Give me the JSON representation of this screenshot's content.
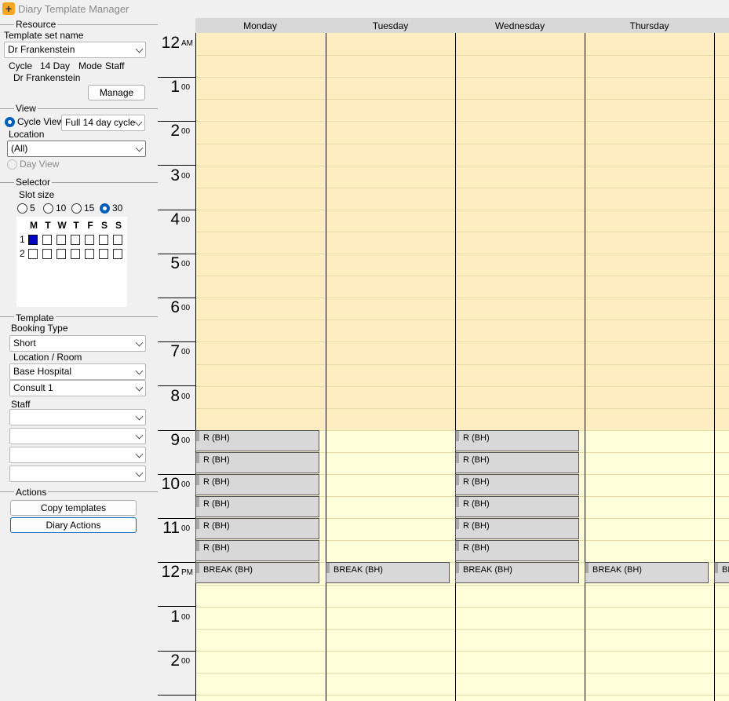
{
  "window": {
    "title": "Diary Template Manager"
  },
  "resource": {
    "group_label": "Resource",
    "template_set_label": "Template set name",
    "template_set_value": "Dr Frankenstein",
    "cycle_label": "Cycle",
    "cycle_value": "14 Day",
    "mode_label": "Mode",
    "mode_value": "Staff",
    "resource_name": "Dr Frankenstein",
    "manage_label": "Manage"
  },
  "view": {
    "group_label": "View",
    "cycle_view_label": "Cycle View",
    "cycle_view_selected": true,
    "cycle_option": "Full 14 day cycle",
    "location_label": "Location",
    "location_value": "(All)",
    "day_view_label": "Day View"
  },
  "selector": {
    "group_label": "Selector",
    "slot_size_label": "Slot size",
    "slot_sizes": [
      "5",
      "10",
      "15",
      "30"
    ],
    "selected_slot_size": "30",
    "day_letters": [
      "M",
      "T",
      "W",
      "T",
      "F",
      "S",
      "S"
    ],
    "week_rows": [
      "1",
      "2"
    ],
    "selected_cell": "week 1, M"
  },
  "template": {
    "group_label": "Template",
    "booking_type_label": "Booking Type",
    "booking_type_value": "Short",
    "location_room_label": "Location / Room",
    "location_value": "Base Hospital",
    "room_value": "Consult 1",
    "staff_label": "Staff",
    "staff_values": [
      "",
      "",
      "",
      ""
    ]
  },
  "actions": {
    "group_label": "Actions",
    "copy_templates_label": "Copy templates",
    "diary_actions_label": "Diary Actions"
  },
  "calendar": {
    "days": [
      "Monday",
      "Tuesday",
      "Wednesday",
      "Thursday"
    ],
    "hours": [
      {
        "h": "12",
        "s": "AM"
      },
      {
        "h": "1",
        "s": "00"
      },
      {
        "h": "2",
        "s": "00"
      },
      {
        "h": "3",
        "s": "00"
      },
      {
        "h": "4",
        "s": "00"
      },
      {
        "h": "5",
        "s": "00"
      },
      {
        "h": "6",
        "s": "00"
      },
      {
        "h": "7",
        "s": "00"
      },
      {
        "h": "8",
        "s": "00"
      },
      {
        "h": "9",
        "s": "00"
      },
      {
        "h": "10",
        "s": "00"
      },
      {
        "h": "11",
        "s": "00"
      },
      {
        "h": "12",
        "s": "PM"
      },
      {
        "h": "1",
        "s": "00"
      },
      {
        "h": "2",
        "s": "00"
      }
    ],
    "colors": {
      "off_hours": "#fdedc0",
      "working_hours": "#ffffd9",
      "grid_line": "#e6dcaa",
      "slot": "#d8d8d8"
    },
    "working_start_hour": 9,
    "slots": [
      {
        "day": 0,
        "start": 9.0,
        "label": "R (BH)"
      },
      {
        "day": 0,
        "start": 9.5,
        "label": "R (BH)"
      },
      {
        "day": 0,
        "start": 10.0,
        "label": "R (BH)"
      },
      {
        "day": 0,
        "start": 10.5,
        "label": "R (BH)"
      },
      {
        "day": 0,
        "start": 11.0,
        "label": "R (BH)"
      },
      {
        "day": 0,
        "start": 11.5,
        "label": "R (BH)"
      },
      {
        "day": 0,
        "start": 12.0,
        "label": "BREAK (BH)"
      },
      {
        "day": 1,
        "start": 12.0,
        "label": "BREAK (BH)"
      },
      {
        "day": 2,
        "start": 9.0,
        "label": "R (BH)"
      },
      {
        "day": 2,
        "start": 9.5,
        "label": "R (BH)"
      },
      {
        "day": 2,
        "start": 10.0,
        "label": "R (BH)"
      },
      {
        "day": 2,
        "start": 10.5,
        "label": "R (BH)"
      },
      {
        "day": 2,
        "start": 11.0,
        "label": "R (BH)"
      },
      {
        "day": 2,
        "start": 11.5,
        "label": "R (BH)"
      },
      {
        "day": 2,
        "start": 12.0,
        "label": "BREAK (BH)"
      },
      {
        "day": 3,
        "start": 12.0,
        "label": "BREAK (BH)"
      },
      {
        "day": 4,
        "start": 12.0,
        "label": "BREAK (BH)"
      }
    ]
  }
}
